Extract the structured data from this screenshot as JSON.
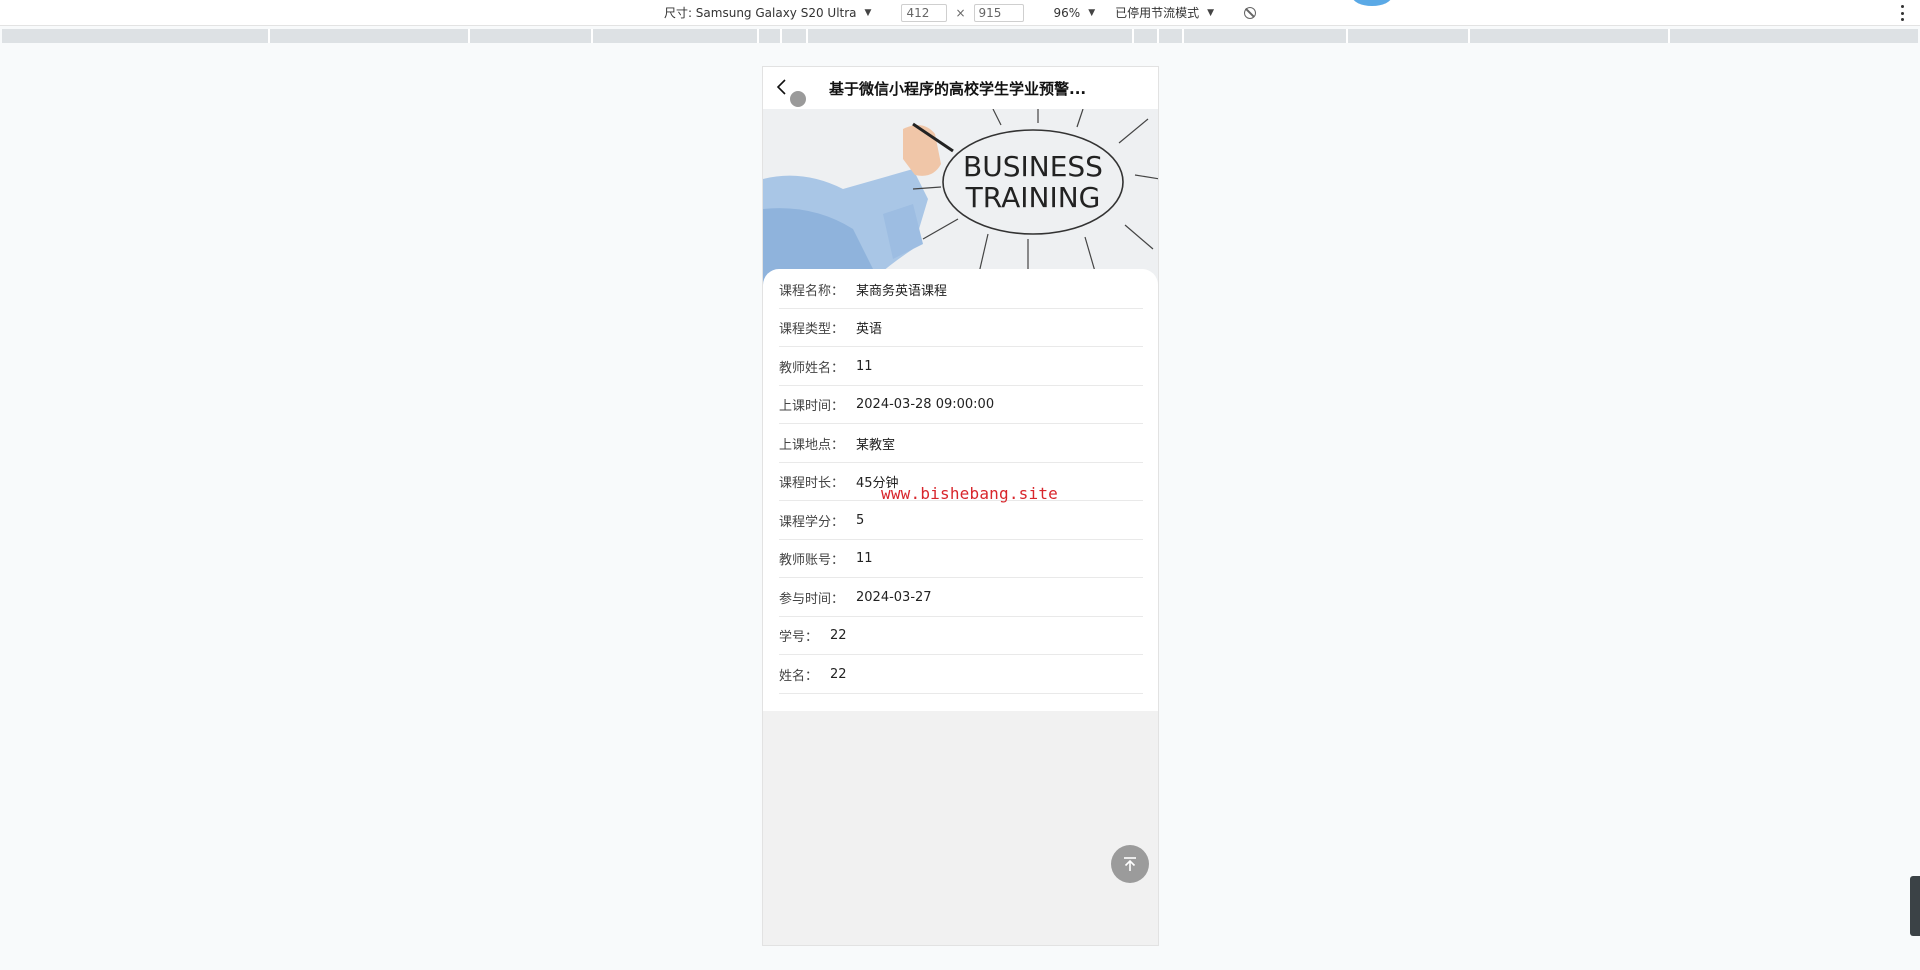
{
  "devtools": {
    "dimensions_label": "尺寸: Samsung Galaxy S20 Ultra",
    "width_value": "412",
    "height_value": "915",
    "times_symbol": "×",
    "zoom_label": "96%",
    "throttle_label": "已停用节流模式",
    "caret": "▼"
  },
  "page": {
    "title": "基于微信小程序的高校学生学业预警...",
    "banner_text_line1": "BUSINESS",
    "banner_text_line2": "TRAINING",
    "watermark": "www.bishebang.site",
    "fields": [
      {
        "label": "课程名称：",
        "value": "某商务英语课程"
      },
      {
        "label": "课程类型：",
        "value": "英语"
      },
      {
        "label": "教师姓名：",
        "value": "11"
      },
      {
        "label": "上课时间：",
        "value": "2024-03-28 09:00:00"
      },
      {
        "label": "上课地点：",
        "value": "某教室"
      },
      {
        "label": "课程时长：",
        "value": "45分钟"
      },
      {
        "label": "课程学分：",
        "value": "5"
      },
      {
        "label": "教师账号：",
        "value": "11"
      },
      {
        "label": "参与时间：",
        "value": "2024-03-27"
      },
      {
        "label": "学号：",
        "value": "22"
      },
      {
        "label": "姓名：",
        "value": "22"
      }
    ]
  },
  "icons": {
    "back": "chevron-left-icon",
    "back_to_top": "arrow-up-to-line-icon",
    "more": "kebab-menu-icon",
    "no_throttle": "no-symbol-icon"
  }
}
